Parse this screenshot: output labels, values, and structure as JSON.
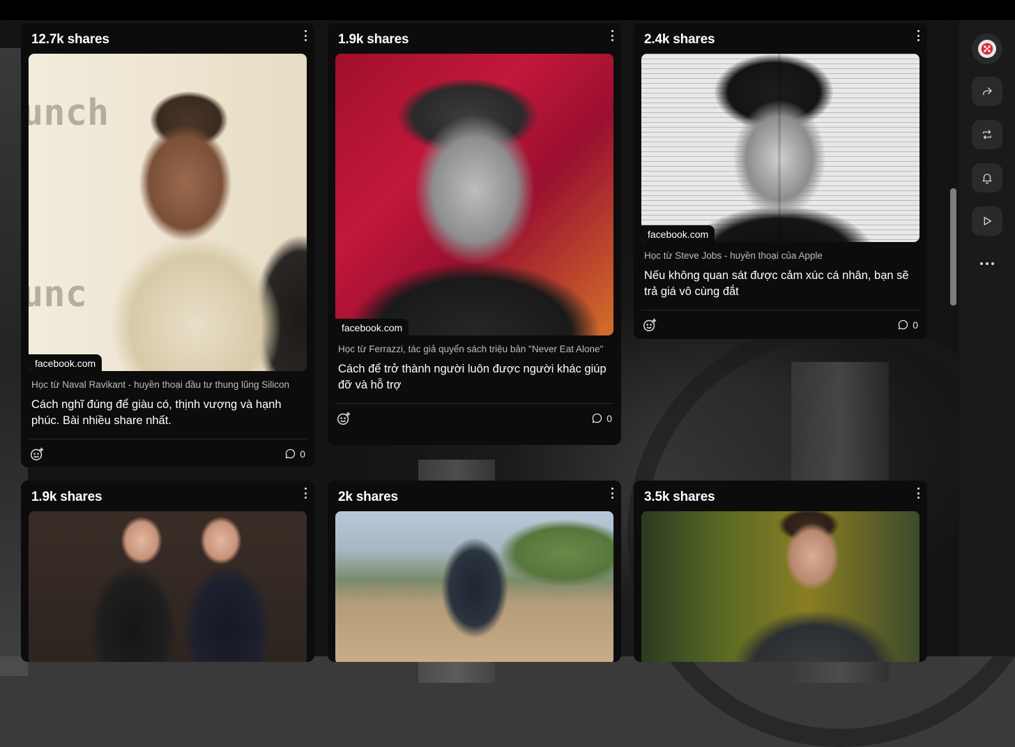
{
  "cards": [
    {
      "shares": "12.7k shares",
      "source": "facebook.com",
      "subtitle": "Học từ Naval Ravikant - huyền thoại đầu tư thung lũng Silicon",
      "headline": "Cách nghĩ đúng để giàu có, thịnh vượng và hạnh phúc. Bài nhiều share nhất.",
      "comments": "0"
    },
    {
      "shares": "1.9k shares",
      "source": "facebook.com",
      "subtitle": "Học từ Ferrazzi, tác giả quyển sách triệu bản \"Never Eat Alone\"",
      "headline": "Cách để trở thành người luôn được người khác giúp đỡ và hỗ trợ",
      "comments": "0"
    },
    {
      "shares": "2.4k shares",
      "source": "facebook.com",
      "subtitle": "Học từ Steve Jobs - huyền thoại của Apple",
      "headline": "Nếu không quan sát được cảm xúc cá nhân, bạn sẽ trả giá vô cùng đắt",
      "comments": "0"
    },
    {
      "shares": "1.9k shares"
    },
    {
      "shares": "2k shares"
    },
    {
      "shares": "3.5k shares"
    }
  ],
  "sidebar": {
    "icons": [
      "avatar-icon",
      "share-icon",
      "repost-icon",
      "bell-icon",
      "play-icon",
      "more-icon"
    ]
  },
  "colors": {
    "card_bg": "#0c0c0d",
    "rail_bg": "#1a1a1b",
    "rail_button": "#2a2a2c",
    "avatar_accent": "#e0262e"
  }
}
